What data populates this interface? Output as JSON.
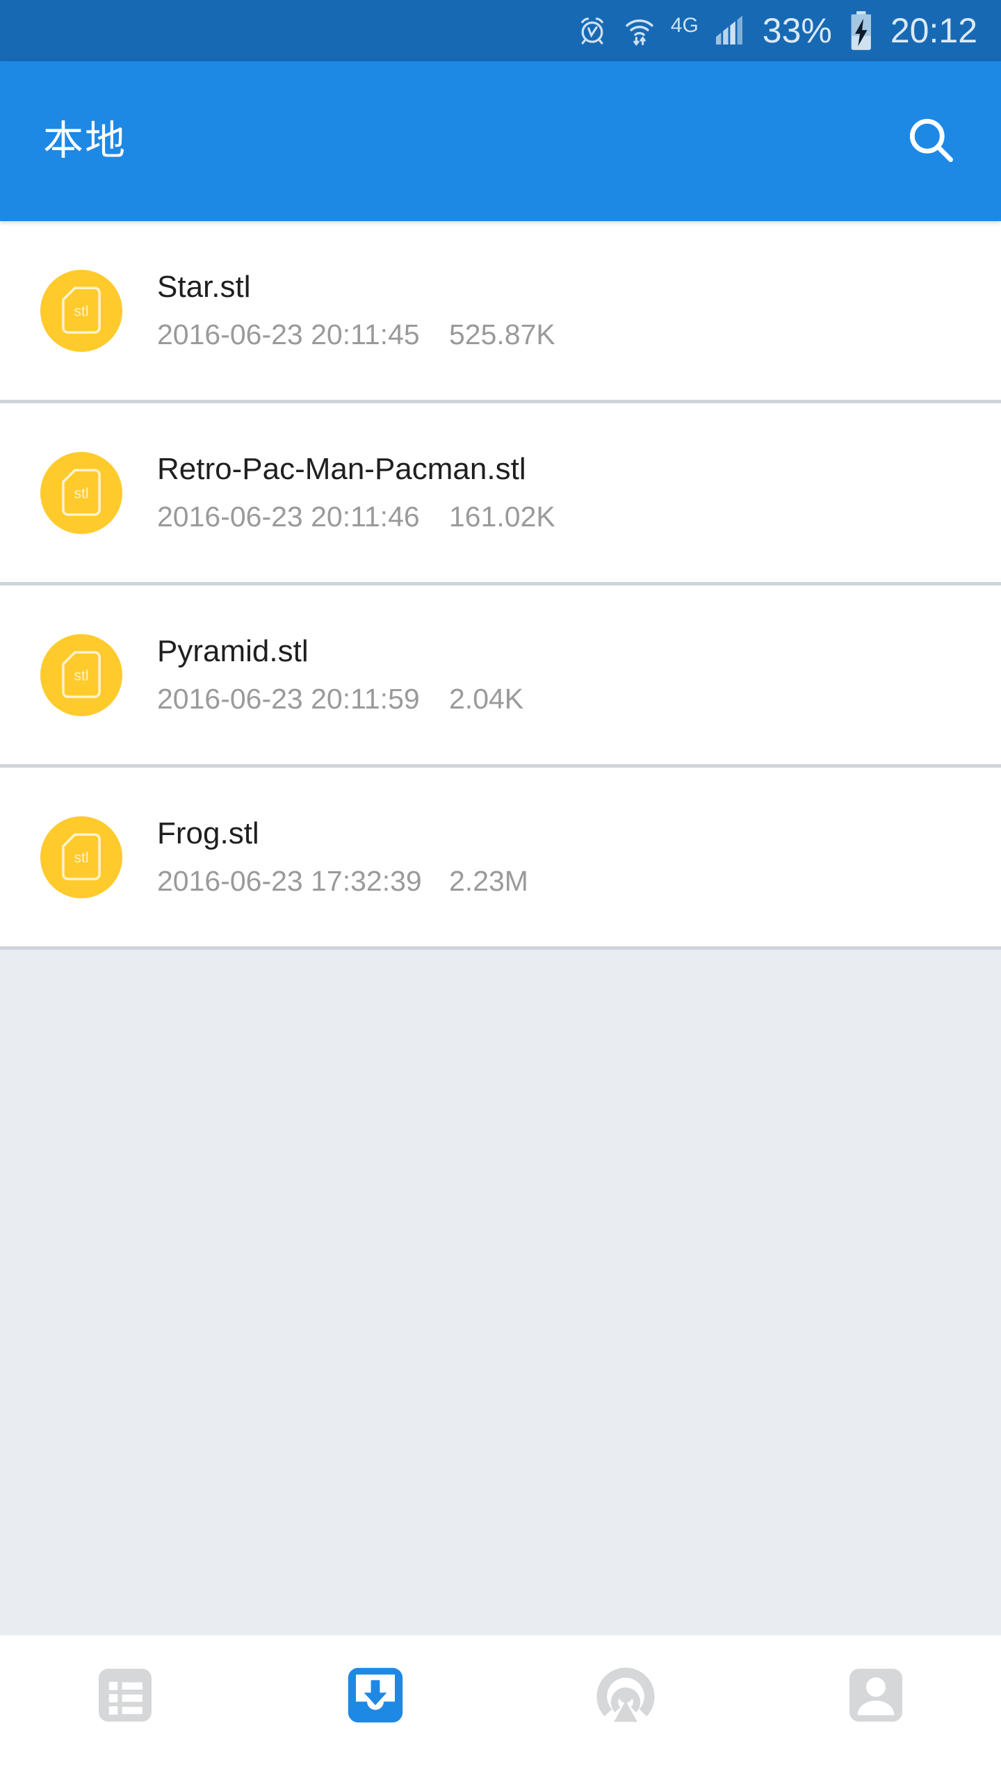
{
  "status_bar": {
    "battery_percent": "33%",
    "time": "20:12",
    "network_type": "4G",
    "icons": [
      "alarm-icon",
      "wifi-icon",
      "network-type-label",
      "signal-bars-icon",
      "battery-percent-label",
      "battery-charging-icon",
      "clock-time-label"
    ],
    "colors": {
      "background": "#1769b4",
      "foreground": "#dce9f4"
    }
  },
  "app_bar": {
    "title": "本地",
    "search_icon": "search-icon",
    "colors": {
      "background": "#1e88e5",
      "foreground": "#ffffff"
    }
  },
  "file_list": {
    "icon_label": "stl",
    "icon_color": "#ffca2c",
    "items": [
      {
        "name": "Star.stl",
        "date": "2016-06-23 20:11:45",
        "size": "525.87K",
        "icon": "stl-file-icon"
      },
      {
        "name": "Retro-Pac-Man-Pacman.stl",
        "date": "2016-06-23 20:11:46",
        "size": "161.02K",
        "icon": "stl-file-icon"
      },
      {
        "name": "Pyramid.stl",
        "date": "2016-06-23 20:11:59",
        "size": "2.04K",
        "icon": "stl-file-icon"
      },
      {
        "name": "Frog.stl",
        "date": "2016-06-23 17:32:39",
        "size": "2.23M",
        "icon": "stl-file-icon"
      }
    ]
  },
  "empty_area": {
    "background": "#e9edf1"
  },
  "bottom_nav": {
    "active_color": "#1e88e5",
    "inactive_color": "#d5d7d9",
    "items": [
      {
        "icon": "list-icon",
        "active": false
      },
      {
        "icon": "download-inbox-icon",
        "active": true
      },
      {
        "icon": "broadcast-icon",
        "active": false
      },
      {
        "icon": "profile-icon",
        "active": false
      }
    ]
  }
}
